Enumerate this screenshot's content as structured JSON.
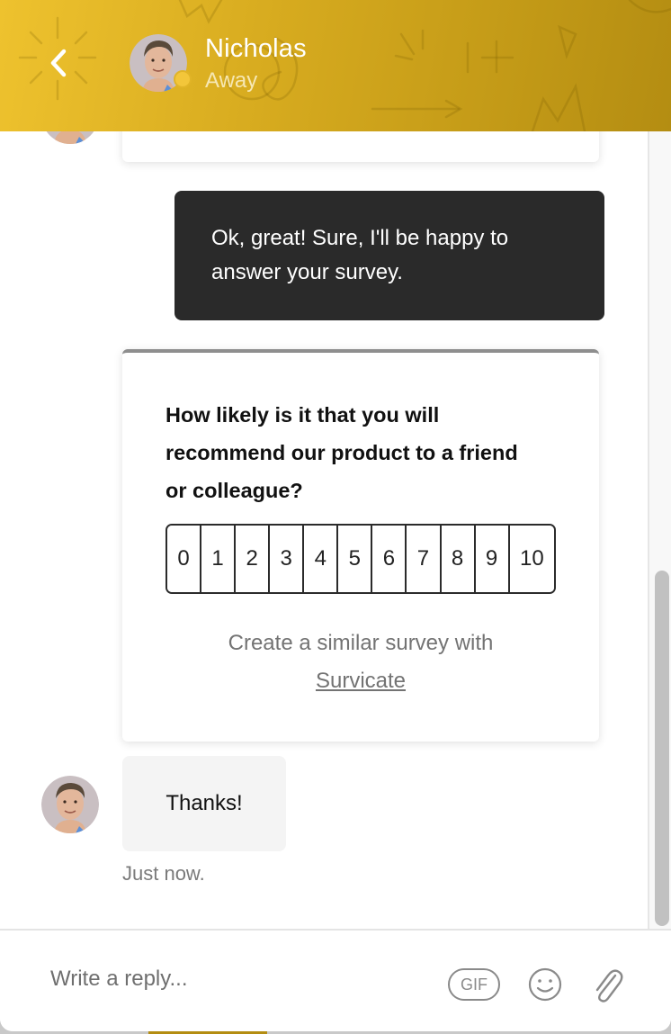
{
  "header": {
    "back_icon": "chevron-left-icon",
    "contact_name": "Nicholas",
    "contact_status": "Away",
    "status_color": "#f3c63a",
    "brand_gradient": [
      "#eec22e",
      "#b48d12"
    ]
  },
  "messages": {
    "user_message": "Ok, great! Sure, I'll be happy to answer your survey.",
    "survey": {
      "question": "How likely is it that you will recommend our product to a friend or colleague?",
      "scale": [
        "0",
        "1",
        "2",
        "3",
        "4",
        "5",
        "6",
        "7",
        "8",
        "9",
        "10"
      ],
      "footer_text": "Create a similar survey with",
      "footer_link": "Survicate"
    },
    "agent_message": "Thanks!",
    "timestamp": "Just now."
  },
  "composer": {
    "placeholder": "Write a reply...",
    "value": "",
    "gif_label": "GIF",
    "emoji_icon": "smiley-icon",
    "attach_icon": "paperclip-icon"
  }
}
